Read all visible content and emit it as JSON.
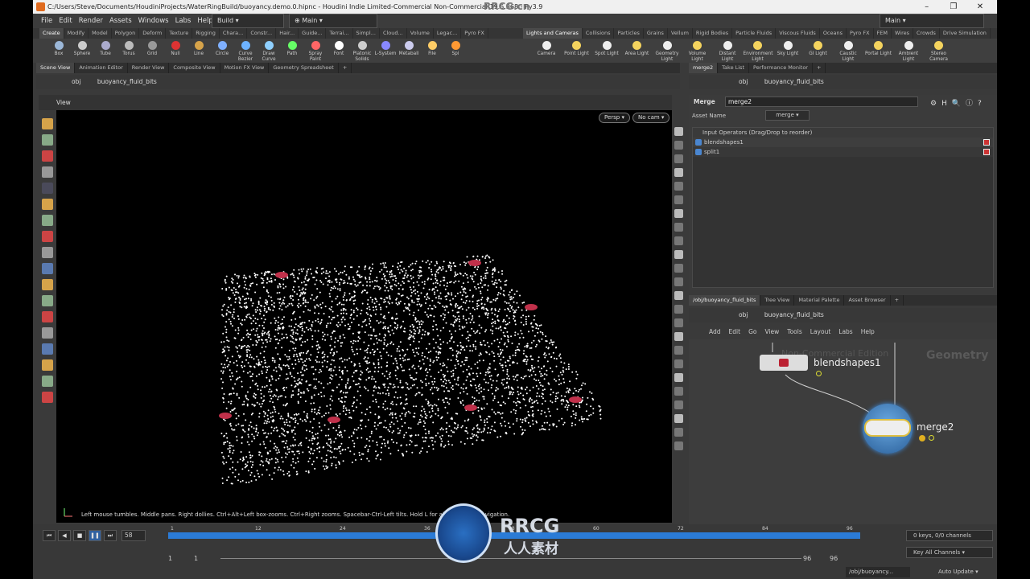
{
  "window": {
    "title": "C:/Users/Steve/Documents/HoudiniProjects/WaterRingBuild/buoyancy.demo.0.hipnc - Houdini Indie Limited-Commercial Non-Commercial 19.5.368 - Py3.9",
    "min": "–",
    "max": "❐",
    "close": "✕"
  },
  "watermark_top": "RRCG.cn",
  "menu": [
    "File",
    "Edit",
    "Render",
    "Assets",
    "Windows",
    "Labs",
    "Help"
  ],
  "desktop_build": "Build",
  "desktop_main_left": "Main",
  "desktop_main_right": "Main",
  "shelf_tabs_left": [
    "Create",
    "Modify",
    "Model",
    "Polygon",
    "Deform",
    "Texture",
    "Rigging",
    "Chara...",
    "Constr...",
    "Hair...",
    "Guide...",
    "Terrai...",
    "Simpl...",
    "Cloud...",
    "Volume",
    "Legac...",
    "Pyro FX"
  ],
  "shelf_tabs_right": [
    "Lights and Cameras",
    "Collisions",
    "Particles",
    "Grains",
    "Vellum",
    "Rigid Bodies",
    "Particle Fluids",
    "Viscous Fluids",
    "Oceans",
    "Pyro FX",
    "FEM",
    "Wires",
    "Crowds",
    "Drive Simulation"
  ],
  "tools_left": [
    "Box",
    "Sphere",
    "Tube",
    "Torus",
    "Grid",
    "Null",
    "Line",
    "Circle",
    "Curve Bezier",
    "Draw Curve",
    "Path",
    "Spray Paint",
    "Font",
    "Platonic Solids",
    "L-System",
    "Metaball",
    "File",
    "Spi"
  ],
  "tools_right": [
    "Camera",
    "Point Light",
    "Spot Light",
    "Area Light",
    "Geometry Light",
    "Volume Light",
    "Distant Light",
    "Environment Light",
    "Sky Light",
    "GI Light",
    "Caustic Light",
    "Portal Light",
    "Ambient Light",
    "Stereo Camera"
  ],
  "left_pane_tabs": [
    "Scene View",
    "Animation Editor",
    "Render View",
    "Composite View",
    "Motion FX View",
    "Geometry Spreadsheet"
  ],
  "right_top_tabs": [
    "merge2",
    "Take List",
    "Performance Monitor"
  ],
  "right_bottom_tabs": [
    "/obj/buoyancy_fluid_bits",
    "Tree View",
    "Material Palette",
    "Asset Browser"
  ],
  "path": {
    "obj": "obj",
    "node": "buoyancy_fluid_bits"
  },
  "viewer": {
    "label": "View",
    "persp": "Persp ▾",
    "cam": "No cam ▾",
    "status": "Left mouse tumbles. Middle pans. Right dollies. Ctrl+Alt+Left box-zooms. Ctrl+Right zooms. Spacebar-Ctrl-Left tilts. Hold L for al... ...Person Navigation."
  },
  "param": {
    "type": "Merge",
    "name": "merge2",
    "asset_label": "Asset Name",
    "asset_value": "merge",
    "list_header": "Input Operators (Drag/Drop to reorder)",
    "inputs": [
      "blendshapes1",
      "split1"
    ]
  },
  "network": {
    "menu": [
      "Add",
      "Edit",
      "Go",
      "View",
      "Tools",
      "Layout",
      "Labs",
      "Help"
    ],
    "context": "Geometry",
    "edition": "Non-Commercial Edition",
    "nodes": [
      {
        "name": "blendshapes1"
      },
      {
        "name": "merge2"
      }
    ]
  },
  "timeline": {
    "frame": "58",
    "ticks": [
      "1",
      "12",
      "24",
      "36",
      "48",
      "60",
      "72",
      "84",
      "96"
    ],
    "start": "1",
    "start2": "1",
    "end": "96",
    "end2": "96",
    "keys": "0 keys, 0/0 channels",
    "key_all": "Key All Channels",
    "path": "/obj/buoyancy...",
    "update": "Auto Update"
  },
  "brand": {
    "top": "RRCG",
    "bottom": "人人素材"
  },
  "colors": {
    "accent": "#2b7bd6",
    "particles": "#ffffff",
    "hot": "#c0304a"
  }
}
